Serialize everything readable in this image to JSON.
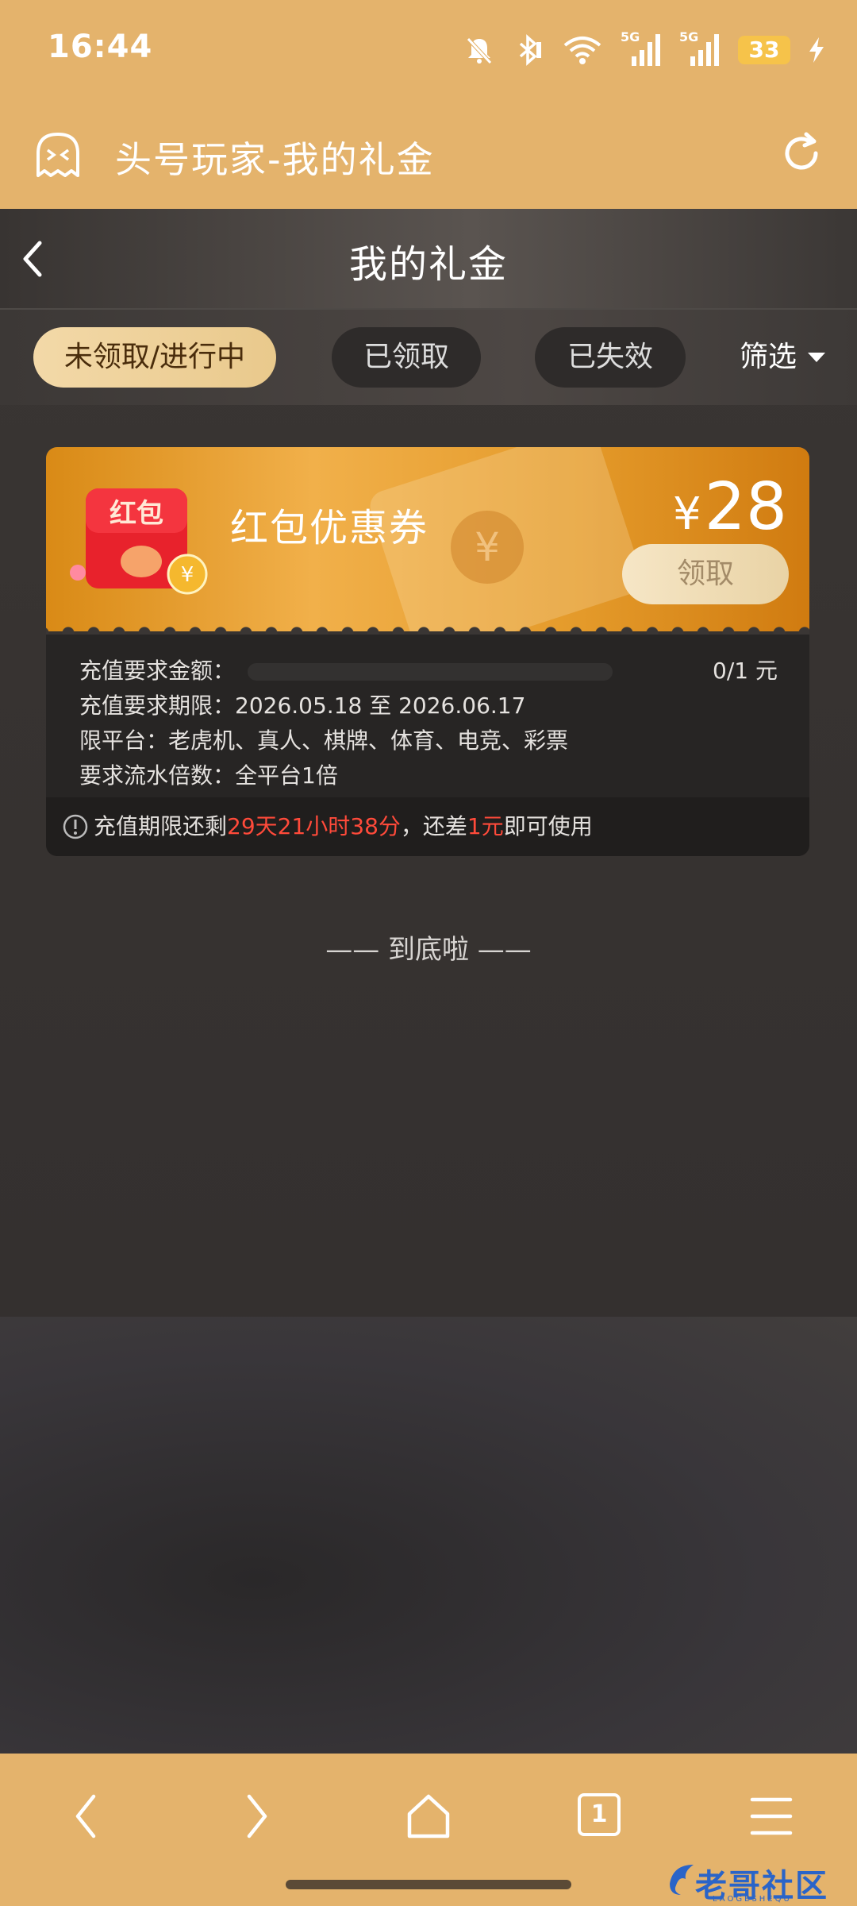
{
  "status_bar": {
    "time": "16:44",
    "network_1": "5G",
    "network_2": "5G",
    "battery": "33"
  },
  "browser": {
    "title": "头号玩家-我的礼金"
  },
  "page": {
    "title": "我的礼金",
    "tabs": [
      {
        "label": "未领取/进行中",
        "active": true
      },
      {
        "label": "已领取",
        "active": false
      },
      {
        "label": "已失效",
        "active": false
      }
    ],
    "filter_label": "筛选"
  },
  "coupon": {
    "badge_text": "红包",
    "coin_symbol": "¥",
    "name": "红包优惠券",
    "currency": "¥",
    "amount": "28",
    "claim_label": "领取",
    "recharge_amount_label": "充值要求金额：",
    "recharge_progress": "0/1 元",
    "period_line": "充值要求期限：2026.05.18 至 2026.06.17",
    "platform_line": "限平台：老虎机、真人、棋牌、体育、电竞、彩票",
    "turnover_line": "要求流水倍数：全平台1倍",
    "notice": {
      "prefix": "充值期限还剩",
      "remaining": "29天21小时38分",
      "middle": "，还差",
      "shortfall": "1元",
      "suffix": "即可使用"
    }
  },
  "end_text": "—— 到底啦 ——",
  "bottom_nav": {
    "tab_count": "1"
  },
  "watermark": {
    "text": "老哥社区",
    "sub": "LAOGESHEQU"
  },
  "colors": {
    "brand_bar": "#e4b36c",
    "coupon_orange": "#f1b04a",
    "highlight_red": "#ff4a3a"
  }
}
